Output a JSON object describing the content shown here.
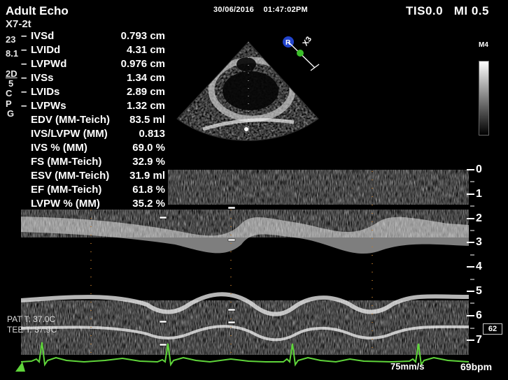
{
  "header": {
    "app_title": "Adult Echo",
    "datetime": "30/06/2016    01:47:02PM",
    "tis_mi": "TIS0.0   MI 0.5"
  },
  "left_panel": {
    "probe": "X7-2t",
    "line2": "23",
    "line3": "8.1",
    "mode": "2D",
    "line5": "5",
    "line6": "C",
    "line7": "P",
    "line8": "G"
  },
  "measurements": [
    {
      "label": "IVSd",
      "value": "0.793 cm",
      "dash": true
    },
    {
      "label": "LVIDd",
      "value": "4.31 cm",
      "dash": true
    },
    {
      "label": "LVPWd",
      "value": "0.976 cm",
      "dash": true
    },
    {
      "label": "IVSs",
      "value": "1.34 cm",
      "dash": true
    },
    {
      "label": "LVIDs",
      "value": "2.89 cm",
      "dash": true
    },
    {
      "label": "LVPWs",
      "value": "1.32 cm",
      "dash": true
    },
    {
      "label": "EDV (MM-Teich)",
      "value": "83.5 ml",
      "dash": false
    },
    {
      "label": "IVS/LVPW (MM)",
      "value": "0.813",
      "dash": false
    },
    {
      "label": "IVS % (MM)",
      "value": "69.0 %",
      "dash": false
    },
    {
      "label": "FS (MM-Teich)",
      "value": "32.9 %",
      "dash": false
    },
    {
      "label": "ESV (MM-Teich)",
      "value": "31.9 ml",
      "dash": false
    },
    {
      "label": "EF (MM-Teich)",
      "value": "61.8 %",
      "dash": false
    },
    {
      "label": "LVPW % (MM)",
      "value": "35.2 %",
      "dash": false
    }
  ],
  "grayscale": {
    "label": "M4"
  },
  "probe_orientation": {
    "angle_label": "X3"
  },
  "depth_scale": [
    "0",
    "1",
    "2",
    "3",
    "4",
    "5",
    "6",
    "7"
  ],
  "frame_indicator": "62",
  "temperatures": {
    "pat": "PAT T: 37.0C",
    "tee": "TEE T: 37.9C"
  },
  "footer": {
    "sweep_speed": "75mm/s",
    "heart_rate": "69bpm"
  },
  "colors": {
    "ecg": "#5fd53a",
    "marker_blue": "#2244cc",
    "marker_green": "#3bbf2a",
    "timing_dots": "#c07a2a"
  }
}
